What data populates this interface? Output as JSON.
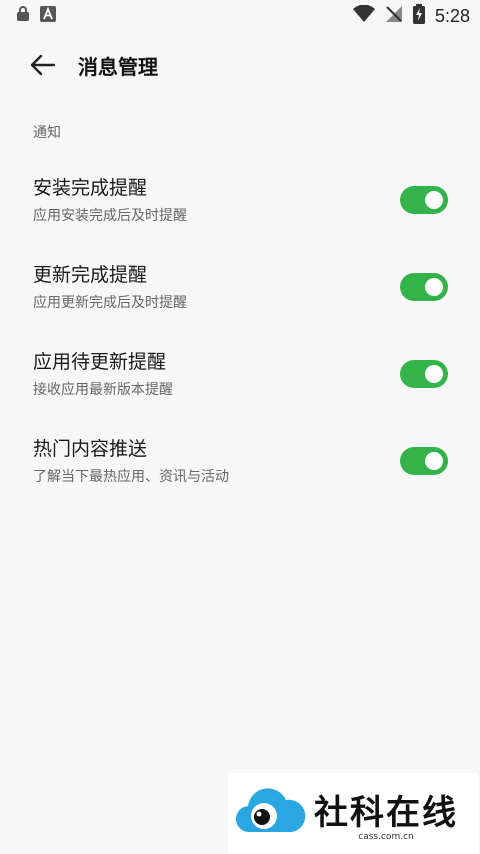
{
  "status_bar": {
    "left_icons": [
      "lock-icon",
      "app-a-icon"
    ],
    "right_icons": [
      "wifi-icon",
      "no-signal-icon",
      "battery-charging-icon"
    ],
    "time": "5:28"
  },
  "header": {
    "back_icon": "arrow-left-icon",
    "title": "消息管理"
  },
  "section": {
    "label": "通知"
  },
  "settings": [
    {
      "title": "安装完成提醒",
      "subtitle": "应用安装完成后及时提醒",
      "enabled": true
    },
    {
      "title": "更新完成提醒",
      "subtitle": "应用更新完成后及时提醒",
      "enabled": true
    },
    {
      "title": "应用待更新提醒",
      "subtitle": "接收应用最新版本提醒",
      "enabled": true
    },
    {
      "title": "热门内容推送",
      "subtitle": "了解当下最热应用、资讯与活动",
      "enabled": true
    }
  ],
  "watermark": {
    "text": "社科在线",
    "domain": "cass.com.cn"
  },
  "colors": {
    "toggle_on": "#34b34a",
    "background": "#f7f7f7",
    "logo_blue": "#2aa7e0"
  }
}
